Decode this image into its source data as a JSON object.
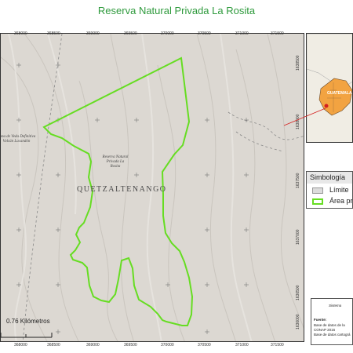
{
  "title": "Reserva Natural Privada La Rosita",
  "x_ticks": [
    "368000",
    "368500",
    "369000",
    "369500",
    "370000",
    "370500",
    "371000",
    "371500"
  ],
  "y_ticks": [
    "1638500",
    "1638000",
    "1637500",
    "1637000",
    "1636500",
    "1636000"
  ],
  "labels": {
    "zona_veda": "Zona de Veda Definitiva Volcán Lacandón",
    "reserva": "Reserva Natural Privada La Rosita",
    "region": "QUETZALTENANGO"
  },
  "inset": {
    "guatemala": "GUATEMALA"
  },
  "legend": {
    "title": "Simbología",
    "items": [
      {
        "label": "Límite",
        "fill": "#dcdcdc",
        "stroke": "#999999"
      },
      {
        "label": "Área pr",
        "fill": "#ffffff",
        "stroke": "#66dd22"
      }
    ]
  },
  "info": {
    "header": "Sistema",
    "source_label": "Fuente:",
    "line1": "Base de datos de la",
    "line2": "CONAP 2016",
    "line3": "Base de datos cartográ"
  },
  "scale_bar": {
    "label": "0.76 Kilómetros"
  },
  "colors": {
    "boundary": "#66dd22",
    "title": "#2e9a3c",
    "terrain": "#dcd8d2"
  }
}
